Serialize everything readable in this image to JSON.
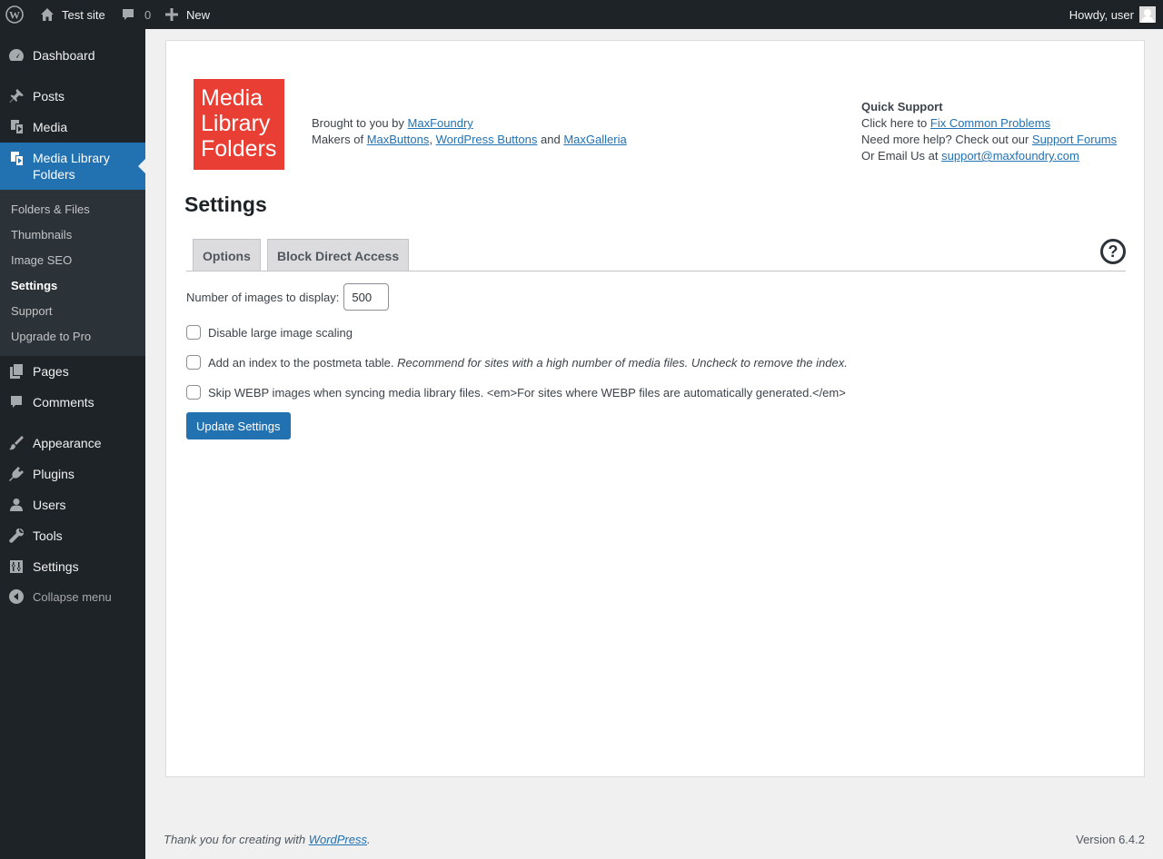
{
  "adminbar": {
    "site_name": "Test site",
    "comments_count": "0",
    "new_label": "New",
    "howdy": "Howdy, user"
  },
  "sidebar": {
    "items": [
      {
        "label": "Dashboard",
        "icon": "dashboard-icon"
      },
      {
        "label": "Posts",
        "icon": "pin-icon"
      },
      {
        "label": "Media",
        "icon": "media-icon"
      },
      {
        "label": "Media Library Folders",
        "icon": "media-folders-icon"
      },
      {
        "label": "Pages",
        "icon": "pages-icon"
      },
      {
        "label": "Comments",
        "icon": "comments-icon"
      },
      {
        "label": "Appearance",
        "icon": "brush-icon"
      },
      {
        "label": "Plugins",
        "icon": "plugin-icon"
      },
      {
        "label": "Users",
        "icon": "user-icon"
      },
      {
        "label": "Tools",
        "icon": "wrench-icon"
      },
      {
        "label": "Settings",
        "icon": "settings-icon"
      }
    ],
    "submenu": [
      "Folders & Files",
      "Thumbnails",
      "Image SEO",
      "Settings",
      "Support",
      "Upgrade to Pro"
    ],
    "collapse": "Collapse menu"
  },
  "logo": {
    "line1": "Media",
    "line2": "Library",
    "line3": "Folders"
  },
  "brought": {
    "prefix": "Brought to you by",
    "maxfoundry": "MaxFoundry",
    "makers_prefix": "Makers of",
    "maxbuttons": "MaxButtons",
    "comma": ",",
    "wpbuttons": "WordPress Buttons",
    "and": "and",
    "maxgalleria": "MaxGalleria"
  },
  "support": {
    "heading": "Quick Support",
    "line1_prefix": "Click here to",
    "line1_link": "Fix Common Problems",
    "line2_prefix": "Need more help? Check out our",
    "line2_link": "Support Forums",
    "line3_prefix": "Or Email Us at",
    "line3_link": "support@maxfoundry.com"
  },
  "page_title": "Settings",
  "tabs": [
    "Options",
    "Block Direct Access"
  ],
  "form": {
    "num_images_label": "Number of images to display:",
    "num_images_value": "500",
    "opt1": "Disable large image scaling",
    "opt2_plain": "Add an index to the postmeta table.",
    "opt2_italic": "Recommend for sites with a high number of media files. Uncheck to remove the index.",
    "opt3": "Skip WEBP images when syncing media library files. <em>For sites where WEBP files are automatically generated.</em>",
    "submit": "Update Settings"
  },
  "footer": {
    "thanks_prefix": "Thank you for creating with",
    "thanks_link": "WordPress",
    "thanks_suffix": ".",
    "version": "Version 6.4.2"
  }
}
